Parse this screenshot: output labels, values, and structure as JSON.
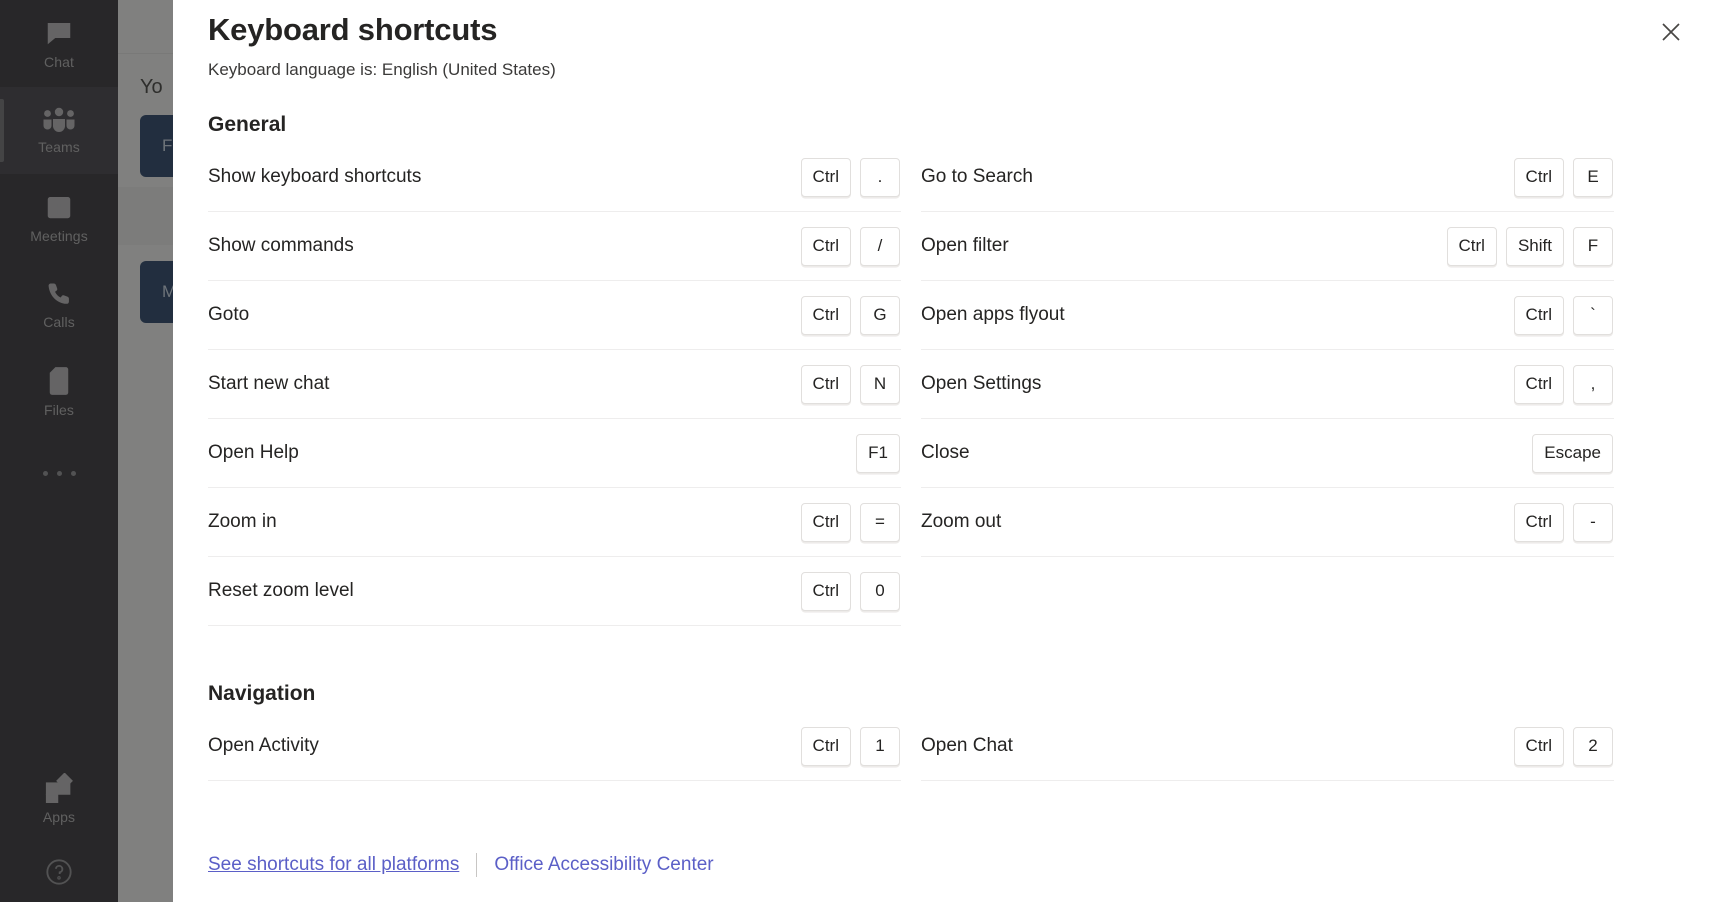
{
  "app": {
    "rail": {
      "items": [
        {
          "label": "Chat",
          "icon": "chat-icon",
          "active": false
        },
        {
          "label": "Teams",
          "icon": "teams-icon",
          "active": true
        },
        {
          "label": "Meetings",
          "icon": "calendar-icon",
          "active": false
        },
        {
          "label": "Calls",
          "icon": "phone-icon",
          "active": false
        },
        {
          "label": "Files",
          "icon": "file-icon",
          "active": false
        }
      ],
      "more_label": "more-options-icon",
      "apps_label": "Apps",
      "help_icon": "help-icon"
    },
    "background": {
      "list_title": "Yo",
      "tile_one": "F",
      "tile_two": "M"
    },
    "colors": {
      "rail_bg": "#2d2c31",
      "rail_active_bg": "#3a3941",
      "tile_blue": "#1f3b63",
      "accent_link": "#5b5fc7",
      "text_primary": "#252423",
      "divider": "#eeeded",
      "key_border": "#e1dfdd"
    }
  },
  "dialog": {
    "title": "Keyboard shortcuts",
    "subtitle": "Keyboard language is: English (United States)",
    "close_label": "close-icon",
    "sections": [
      {
        "title": "General",
        "left": [
          {
            "label": "Show keyboard shortcuts",
            "keys": [
              "Ctrl",
              "."
            ]
          },
          {
            "label": "Show commands",
            "keys": [
              "Ctrl",
              "/"
            ]
          },
          {
            "label": "Goto",
            "keys": [
              "Ctrl",
              "G"
            ]
          },
          {
            "label": "Start new chat",
            "keys": [
              "Ctrl",
              "N"
            ]
          },
          {
            "label": "Open Help",
            "keys": [
              "F1"
            ]
          },
          {
            "label": "Zoom in",
            "keys": [
              "Ctrl",
              "="
            ]
          },
          {
            "label": "Reset zoom level",
            "keys": [
              "Ctrl",
              "0"
            ]
          }
        ],
        "right": [
          {
            "label": "Go to Search",
            "keys": [
              "Ctrl",
              "E"
            ]
          },
          {
            "label": "Open filter",
            "keys": [
              "Ctrl",
              "Shift",
              "F"
            ]
          },
          {
            "label": "Open apps flyout",
            "keys": [
              "Ctrl",
              "`"
            ]
          },
          {
            "label": "Open Settings",
            "keys": [
              "Ctrl",
              ","
            ]
          },
          {
            "label": "Close",
            "keys": [
              "Escape"
            ]
          },
          {
            "label": "Zoom out",
            "keys": [
              "Ctrl",
              "-"
            ]
          }
        ]
      },
      {
        "title": "Navigation",
        "left": [
          {
            "label": "Open Activity",
            "keys": [
              "Ctrl",
              "1"
            ]
          }
        ],
        "right": [
          {
            "label": "Open Chat",
            "keys": [
              "Ctrl",
              "2"
            ]
          }
        ]
      }
    ],
    "footer": {
      "link_all_platforms": "See shortcuts for all platforms",
      "link_accessibility": "Office Accessibility Center"
    }
  }
}
